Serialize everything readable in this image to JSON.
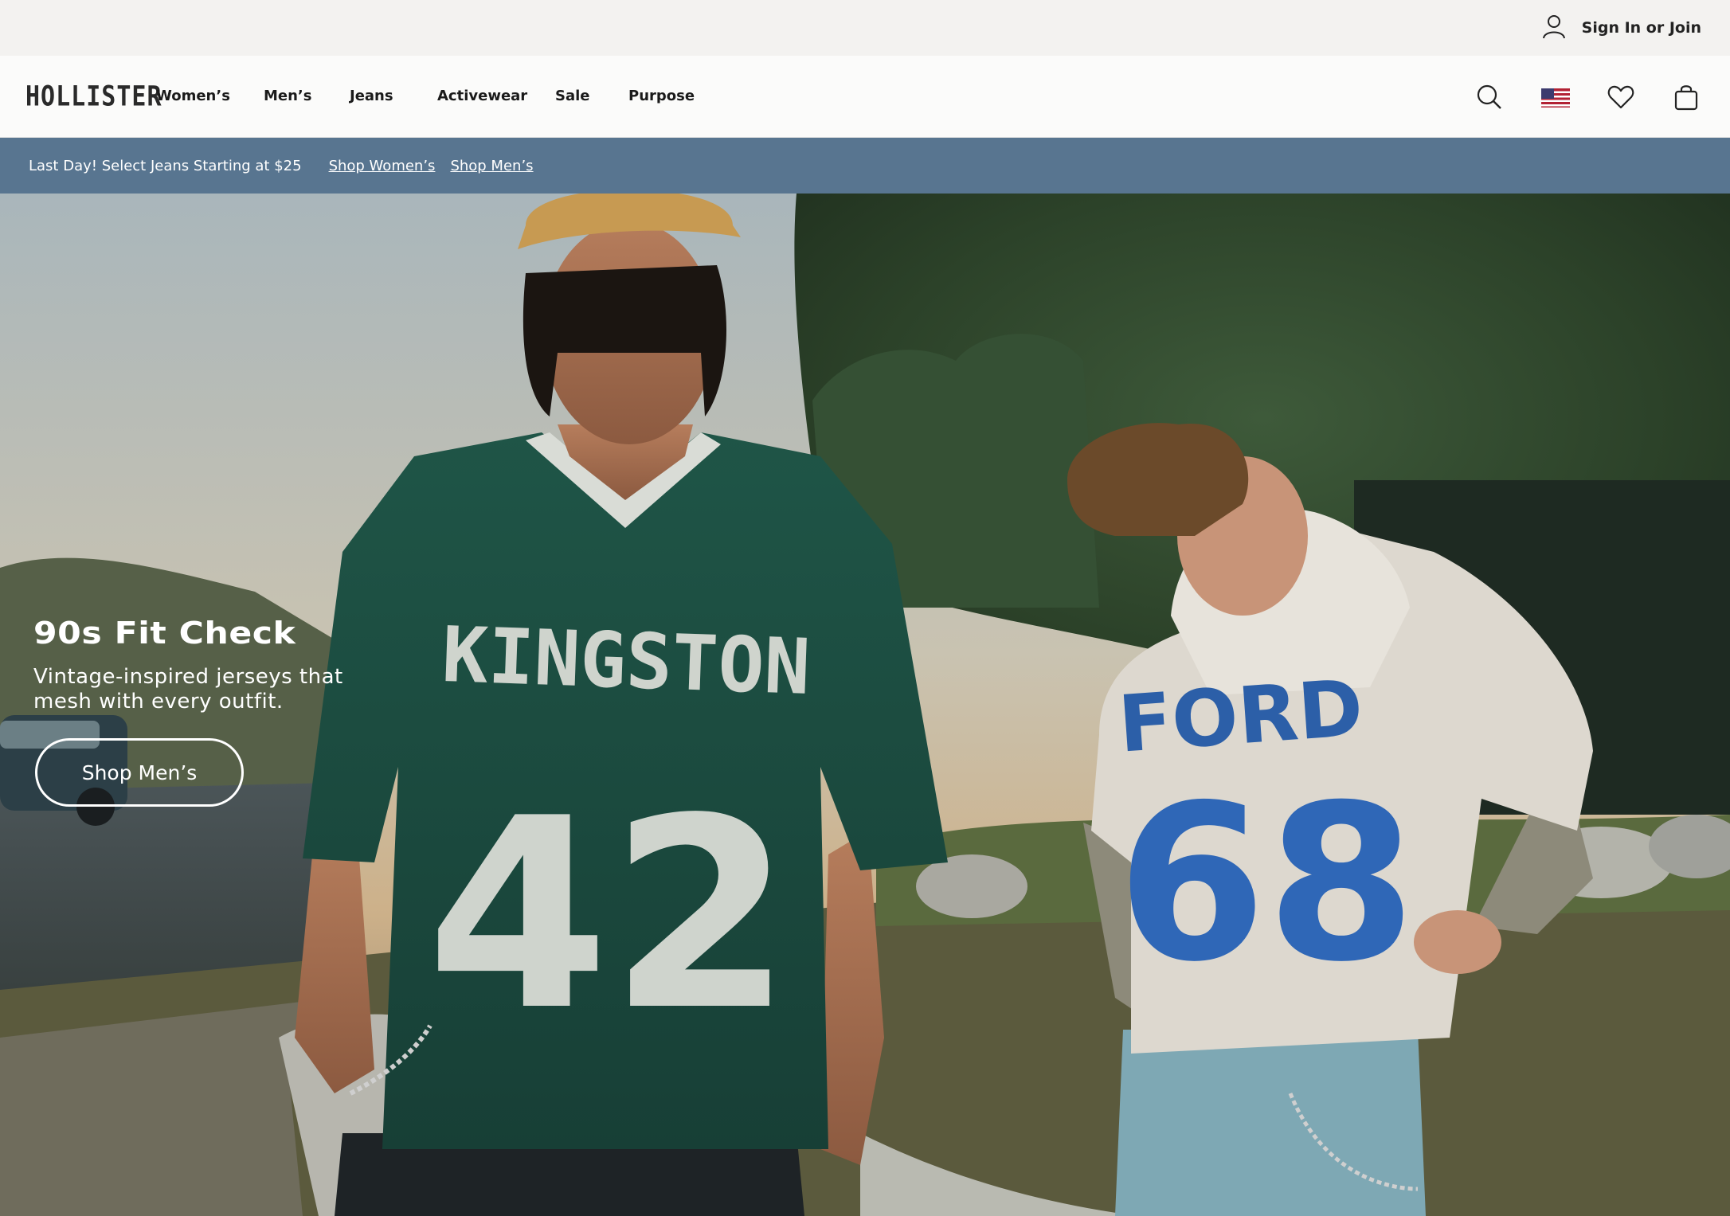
{
  "utility": {
    "sign_in_label": "Sign In or Join",
    "account_icon": "user-icon"
  },
  "header": {
    "logo": "HOLLISTER",
    "nav": [
      {
        "label": "Women’s"
      },
      {
        "label": "Men’s"
      },
      {
        "label": "Jeans"
      },
      {
        "label": "Activewear"
      },
      {
        "label": "Sale"
      },
      {
        "label": "Purpose"
      }
    ],
    "icons": [
      "search-icon",
      "us-flag-icon",
      "heart-icon",
      "shopping-bag-icon"
    ]
  },
  "promo": {
    "text": "Last Day! Select Jeans Starting at $25",
    "links": [
      {
        "label": "Shop Women’s"
      },
      {
        "label": "Shop Men’s"
      }
    ],
    "background": "#587590"
  },
  "hero": {
    "title": "90s Fit Check",
    "subtitle": "Vintage-inspired jerseys that mesh with every outfit.",
    "cta_label": "Shop Men’s",
    "jersey_left": {
      "name": "KINGSTON",
      "number": "42"
    },
    "jersey_right": {
      "name": "FORD",
      "number": "68"
    }
  }
}
